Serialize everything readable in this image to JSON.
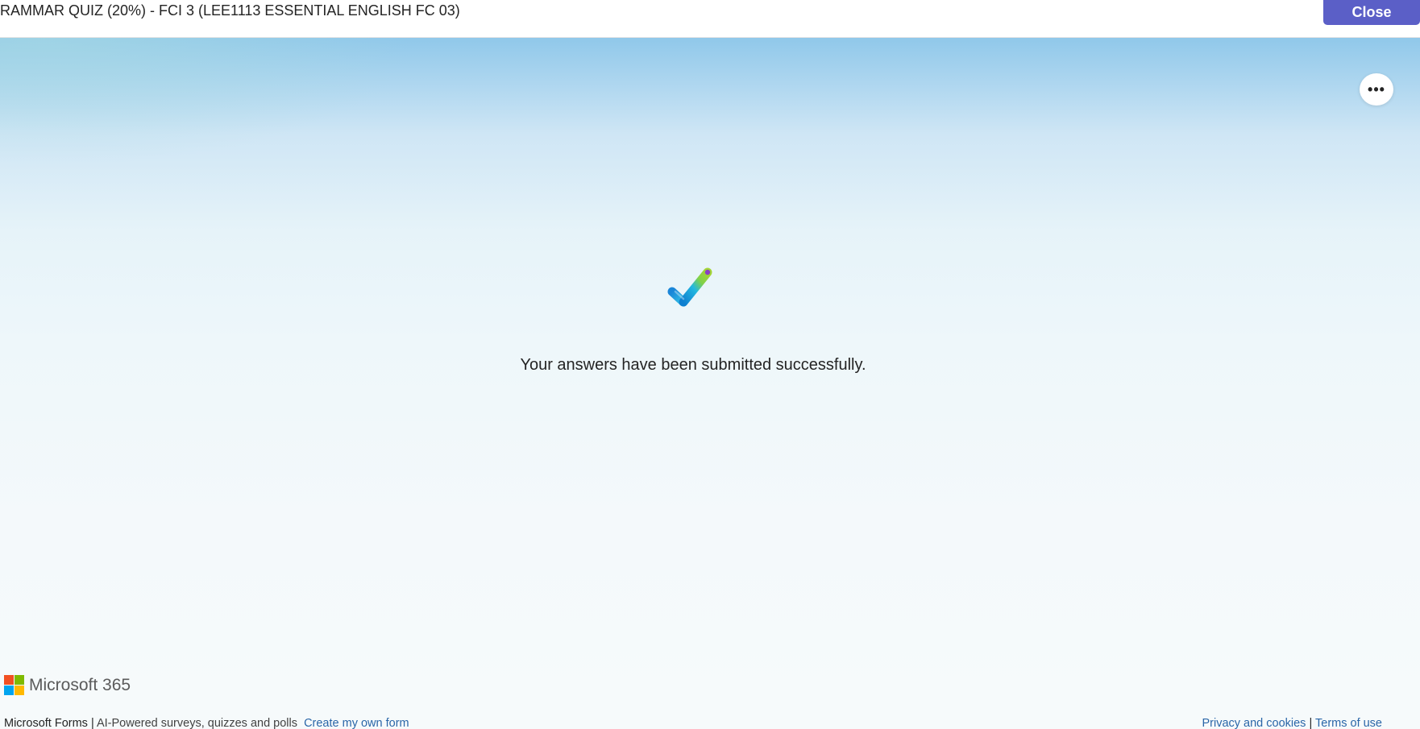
{
  "header": {
    "title": "RAMMAR QUIZ (20%) - FCI 3 (LEE1113 ESSENTIAL ENGLISH FC 03)",
    "close_label": "Close"
  },
  "main": {
    "more_label": "•••",
    "checkmark_icon": "checkmark-icon",
    "message": "Your answers have been submitted successfully."
  },
  "footer": {
    "logo_text": "Microsoft 365",
    "brand": "Microsoft Forms",
    "separator": " | ",
    "tagline": "AI-Powered surveys, quizzes and polls",
    "create_link": "Create my own form",
    "privacy_link": "Privacy and cookies",
    "terms_link": "Terms of use"
  },
  "colors": {
    "accent": "#5b5fc7",
    "link": "#2a66a8",
    "ms_red": "#f25022",
    "ms_green": "#7fba00",
    "ms_blue": "#00a4ef",
    "ms_yellow": "#ffb900"
  }
}
